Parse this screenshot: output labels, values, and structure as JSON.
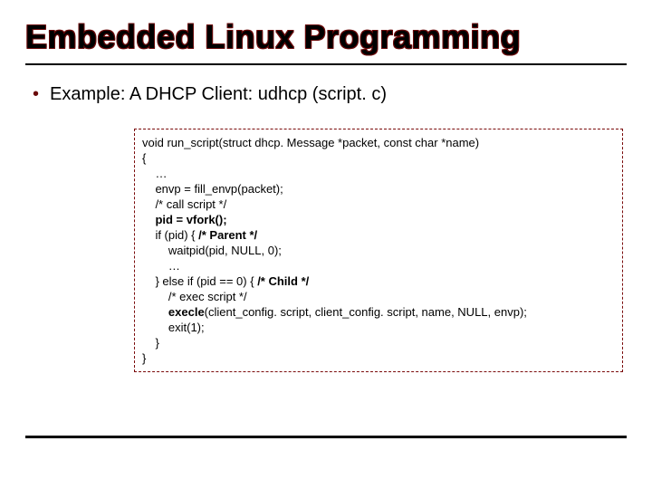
{
  "title": "Embedded Linux Programming",
  "bullet_text": "Example: A DHCP Client: udhcp (script. c)",
  "code": {
    "l0": "void run_script(struct dhcp. Message *packet, const char *name)",
    "l1": "{",
    "l2": "    …",
    "l3": "    envp = fill_envp(packet);",
    "l4": "    /* call script */",
    "l5_b": "    pid = vfork();",
    "l6_a": "    if (pid) { ",
    "l6_b": "/* Parent */",
    "l7": "        waitpid(pid, NULL, 0);",
    "l8": "        …",
    "l9_a": "    } else if (pid == 0) { ",
    "l9_b": "/* Child */",
    "l10": "        /* exec script */",
    "l11_a": "        ",
    "l11_b": "execle",
    "l11_c": "(client_config. script, client_config. script, name, NULL, envp);",
    "l12": "        exit(1);",
    "l13": "    }",
    "l14": "}"
  }
}
